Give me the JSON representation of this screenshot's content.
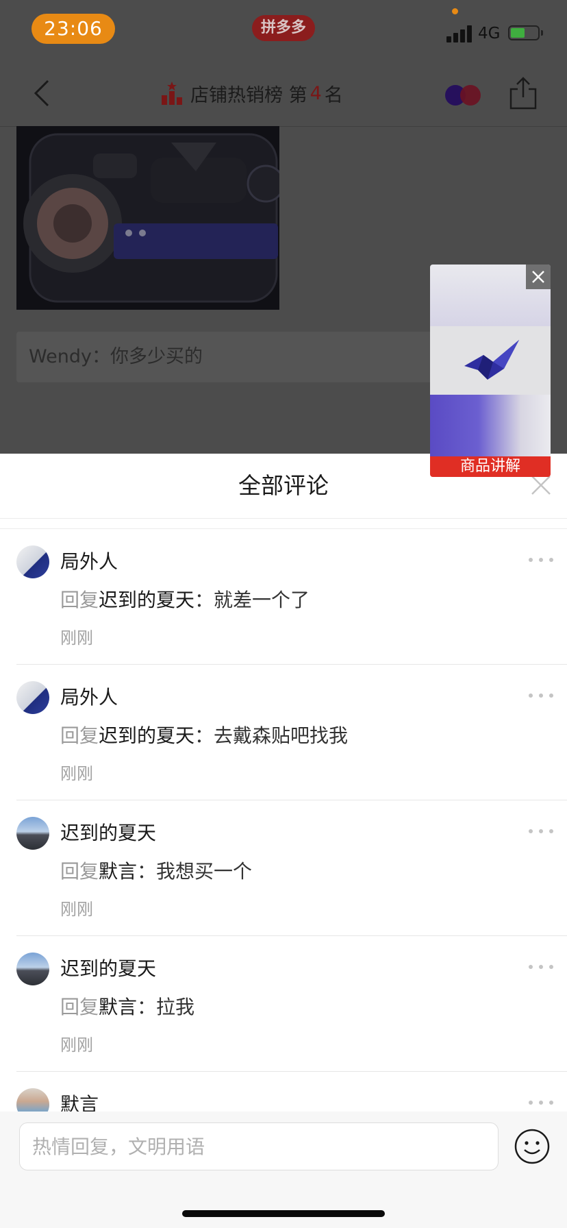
{
  "status_bar": {
    "time": "23:06",
    "app_badge": "拼多多",
    "network": "4G"
  },
  "nav": {
    "rank_prefix": "店铺热销榜 第",
    "rank_number": "4",
    "rank_suffix": "名"
  },
  "background_chat": {
    "text": "Wendy：你多少买的"
  },
  "float_video": {
    "label": "商品讲解"
  },
  "sheet": {
    "title": "全部评论"
  },
  "comments": [
    {
      "user": "局外人",
      "reply_prefix": "回复",
      "reply_to": "迟到的夏天",
      "text": "：就差一个了",
      "time": "刚刚"
    },
    {
      "user": "局外人",
      "reply_prefix": "回复",
      "reply_to": "迟到的夏天",
      "text": "：去戴森贴吧找我",
      "time": "刚刚"
    },
    {
      "user": "迟到的夏天",
      "reply_prefix": "回复",
      "reply_to": "默言",
      "text": "：我想买一个",
      "time": "刚刚"
    },
    {
      "user": "迟到的夏天",
      "reply_prefix": "回复",
      "reply_to": "默言",
      "text": "：拉我",
      "time": "刚刚"
    },
    {
      "user": "默言"
    }
  ],
  "input": {
    "placeholder": "热情回复，文明用语"
  },
  "colors": {
    "accent_red": "#e02e24",
    "time_pill": "#e88a14"
  }
}
